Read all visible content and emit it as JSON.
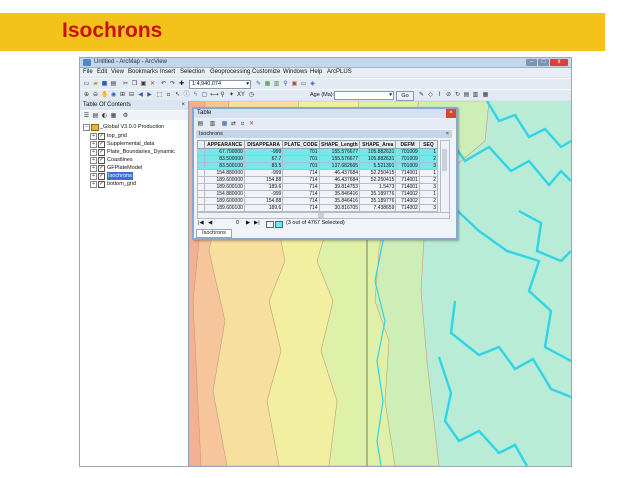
{
  "slide": {
    "title": "Isochrons",
    "banner_color": "#f3c31c",
    "title_color": "#cc0f0f"
  },
  "window": {
    "title": "Untitled - ArcMap - ArcView",
    "min": "–",
    "max": "□",
    "close": "x"
  },
  "menubar": [
    "File",
    "Edit",
    "View",
    "Bookmarks",
    "Insert",
    "Selection",
    "Geoprocessing",
    "Customize",
    "Windows",
    "Help",
    "ArcPLUS"
  ],
  "toolbar1": {
    "scale_value": "1:4,940,074"
  },
  "toolbar2": {
    "time_field": "Age (Ma):",
    "go_label": "Go"
  },
  "toc": {
    "title": "Table Of Contents",
    "root_layer": "_Global V3.0.0 Production",
    "layers": [
      {
        "label": "top_grid",
        "selected": false
      },
      {
        "label": "Supplemental_data",
        "selected": false
      },
      {
        "label": "Plate_Boundaries_Dynamic",
        "selected": false
      },
      {
        "label": "Coastlines",
        "selected": false
      },
      {
        "label": "GFPlateModel",
        "selected": false
      },
      {
        "label": "Isochrons",
        "selected": true
      },
      {
        "label": "bottom_grid",
        "selected": false
      }
    ]
  },
  "table_window": {
    "title": "Table",
    "tab": "Isochrons",
    "columns": [
      "APPEARANCE",
      "DISAPPEARA",
      "PLATE_CODE",
      "SHAPE_Length",
      "SHAPE_Area",
      "DEFM",
      "SEQ"
    ],
    "rows": [
      {
        "cells": [
          "67.700000",
          "-999",
          "701",
          "155.576677",
          "105.882631",
          "701009",
          "1"
        ],
        "selected": true
      },
      {
        "cells": [
          "83.500000",
          "67.7",
          "701",
          "155.576677",
          "105.882631",
          "701009",
          "2"
        ],
        "selected": true
      },
      {
        "cells": [
          "83.500100",
          "83.5",
          "701",
          "137.682665",
          "5.521391",
          "701009",
          "3"
        ],
        "selected": true
      },
      {
        "cells": [
          "154.880000",
          "-999",
          "714",
          "46.437684",
          "52.250415",
          "714001",
          "1"
        ],
        "selected": false
      },
      {
        "cells": [
          "189.600000",
          "154.88",
          "714",
          "46.437684",
          "52.250415",
          "714001",
          "2"
        ],
        "selected": false
      },
      {
        "cells": [
          "189.600100",
          "189.6",
          "714",
          "39.814753",
          "1.5473",
          "714001",
          "3"
        ],
        "selected": false
      },
      {
        "cells": [
          "154.880000",
          "-999",
          "714",
          "35.846416",
          "35.189776",
          "714002",
          "1"
        ],
        "selected": false
      },
      {
        "cells": [
          "189.600000",
          "154.88",
          "714",
          "35.846416",
          "35.189776",
          "714002",
          "2"
        ],
        "selected": false
      },
      {
        "cells": [
          "189.600100",
          "189.6",
          "714",
          "30.816705",
          "7.438659",
          "714002",
          "3"
        ],
        "selected": false
      }
    ],
    "record_value": "0",
    "selection_status": "(3 out of 4767 Selected)",
    "footer_tab": "Isochrons"
  }
}
